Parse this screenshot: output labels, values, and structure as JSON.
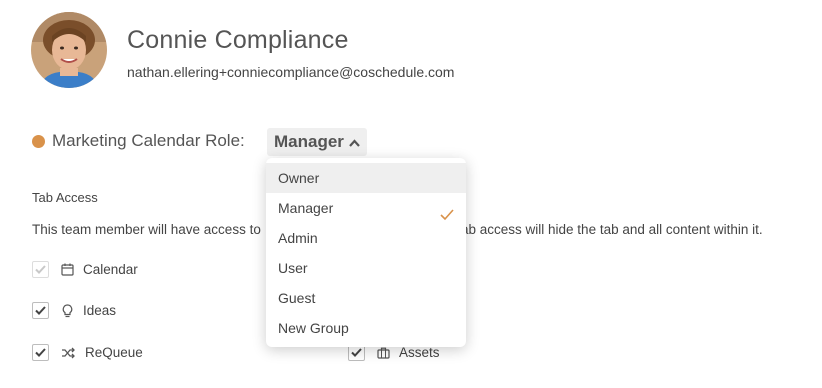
{
  "user": {
    "name": "Connie Compliance",
    "email": "nathan.ellering+conniecompliance@coschedule.com"
  },
  "role": {
    "label": "Marketing Calendar Role:",
    "selected": "Manager",
    "dot_color": "#d9924a",
    "options": [
      "Owner",
      "Manager",
      "Admin",
      "User",
      "Guest",
      "New Group"
    ]
  },
  "tab_access": {
    "heading": "Tab Access",
    "description_left": "This team member will have access to",
    "description_right": "ab access will hide the tab and all content within it.",
    "items": [
      {
        "label": "Calendar",
        "icon": "calendar-icon",
        "checked": true,
        "disabled": true
      },
      {
        "label": "Ideas",
        "icon": "lightbulb-icon",
        "checked": true,
        "disabled": false
      },
      {
        "label": "ReQueue",
        "icon": "shuffle-icon",
        "checked": true,
        "disabled": false
      },
      {
        "label": "Assets",
        "icon": "briefcase-icon",
        "checked": true,
        "disabled": false
      }
    ]
  }
}
